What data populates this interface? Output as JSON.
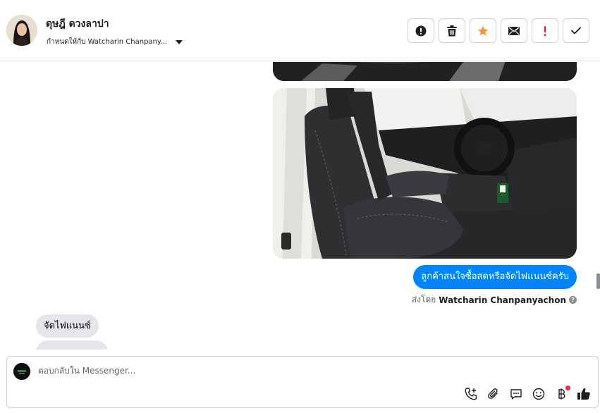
{
  "header": {
    "contact_name": "ดุษฎี ดวงลาปา",
    "assign_label": "กำหนดให้กับ Watcharin Chanpany...",
    "actions": [
      {
        "name": "spam-button",
        "icon": "alert-circle-icon"
      },
      {
        "name": "delete-button",
        "icon": "trash-icon"
      },
      {
        "name": "star-button",
        "icon": "star-icon",
        "color": "#f7923a"
      },
      {
        "name": "mark-unread-button",
        "icon": "envelope-icon"
      },
      {
        "name": "follow-up-button",
        "icon": "exclamation-icon",
        "color": "#e41e3f"
      },
      {
        "name": "done-button",
        "icon": "checkmark-icon"
      }
    ]
  },
  "chat": {
    "outgoing_message": "ลูกค้าสนใจซื้อสดหรือจัดไฟแนนซ์ครับ",
    "sent_by_prefix": "ส่งโดย",
    "sent_by_name": "Watcharin Chanpanyachon",
    "incoming_message": "จัดไฟแนนซ์",
    "outgoing_color": "#0084ff"
  },
  "composer": {
    "placeholder": "ตอบกลับใน Messenger...",
    "tools": [
      "call-add-icon",
      "attachment-icon",
      "saved-reply-icon",
      "emoji-icon",
      "payment-icon",
      "like-icon"
    ]
  }
}
